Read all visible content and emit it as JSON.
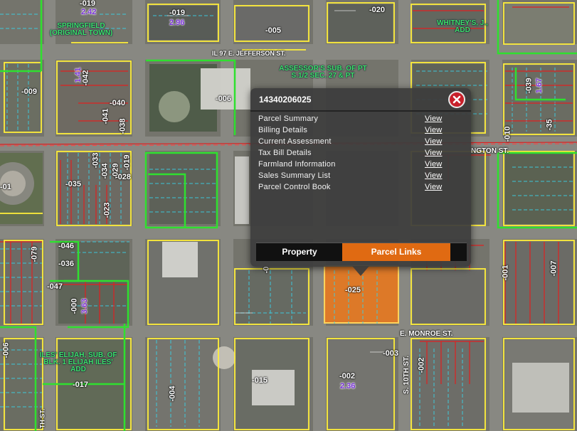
{
  "popup": {
    "parcel_id": "14340206025",
    "items": [
      {
        "label": "Parcel Summary",
        "action": "View"
      },
      {
        "label": "Billing Details",
        "action": "View"
      },
      {
        "label": "Current Assessment",
        "action": "View"
      },
      {
        "label": "Tax Bill Details",
        "action": "View"
      },
      {
        "label": "Farmland Information",
        "action": "View"
      },
      {
        "label": "Sales Summary List",
        "action": "View"
      },
      {
        "label": "Parcel Control Book",
        "action": "View"
      }
    ],
    "tabs": {
      "property": "Property",
      "parcel_links": "Parcel Links"
    },
    "active_tab": "Parcel Links",
    "close_icon": "close-x-icon"
  },
  "map": {
    "streets": [
      "IL 97 E. JEFFERSON ST.",
      "E. MONROE ST.",
      "S. 10TH ST.",
      "NGTON ST.",
      "TH ST."
    ],
    "subdivisions": [
      "SPRINGFIELD (ORIGINAL TOWN)",
      "WHITNEY'S, J., ADD",
      "ASSESSOR'S SUB. OF PT S.1/2 SEC. 27 & PT",
      "ILES' ELIJAH, SUB. OF BLK. 1 ELIJAH ILES' ADD"
    ],
    "parcel_labels": [
      "-019",
      "-019",
      "-020",
      "-005",
      "-009",
      "-006",
      "-040",
      "-041",
      "-038",
      "-042",
      "-039",
      "-35",
      "-010",
      "-033",
      "-034",
      "-029",
      "-019",
      "-028",
      "-035",
      "-023",
      "-01",
      "-046",
      "-036",
      "-079",
      "-047",
      "-000",
      "-025",
      "-001",
      "-007",
      "-006",
      "-003",
      "-002",
      "-002",
      "-004",
      "-015",
      "-017",
      "-0"
    ],
    "acreage_labels": [
      "2.42",
      "2.96",
      "1.41",
      "3.63",
      "2.36",
      "1.67"
    ],
    "colors": {
      "parcel_line": "#ffef3a",
      "subdivision_line": "#2fe02f",
      "lot_line": "#39d0e6",
      "ownership_line": "#e02020",
      "selected_parcel": "#f07a1c",
      "popup_bg": "#3c3c3c",
      "active_tab": "#e06a12",
      "close_button": "#c8202a"
    }
  }
}
